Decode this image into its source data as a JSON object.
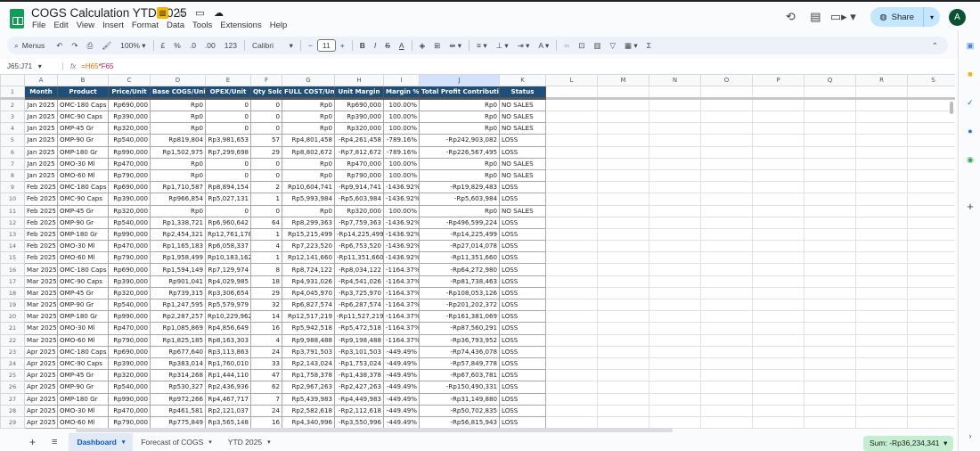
{
  "app": {
    "title": "COGS Calculation YTD 2025",
    "menu": [
      "File",
      "Edit",
      "View",
      "Insert",
      "Format",
      "Data",
      "Tools",
      "Extensions",
      "Help"
    ],
    "share_label": "Share",
    "avatar_letter": "A"
  },
  "toolbar": {
    "search": "Menus",
    "zoom": "100%",
    "currency": "£",
    "percent": "%",
    "dec_decrease": ".0",
    "dec_increase": ".00",
    "number_format": "123",
    "font": "Calibri",
    "font_size": "11"
  },
  "formula_bar": {
    "name_box": "J65:J71",
    "fx": "fx",
    "ref1": "=H65",
    "op": "*",
    "ref2": "F65"
  },
  "columns": [
    "A",
    "B",
    "C",
    "D",
    "E",
    "F",
    "G",
    "H",
    "I",
    "J",
    "K",
    "L",
    "M",
    "N",
    "O",
    "P",
    "Q",
    "R",
    "S"
  ],
  "selected_column": "J",
  "headers": [
    "Month",
    "Product",
    "Price/Unit",
    "Base COGS/Unit",
    "OPEX/Unit",
    "Qty Sold",
    "FULL COST/Unit",
    "Unit Margin",
    "Margin %",
    "Total Profit Contribution",
    "Status"
  ],
  "rows": [
    [
      "Jan 2025",
      "OMC-180 Caps",
      "Rp690,000",
      "Rp0",
      "0",
      "0",
      "Rp0",
      "Rp690,000",
      "100.00%",
      "Rp0",
      "NO SALES"
    ],
    [
      "Jan 2025",
      "OMC-90 Caps",
      "Rp390,000",
      "Rp0",
      "0",
      "0",
      "Rp0",
      "Rp390,000",
      "100.00%",
      "Rp0",
      "NO SALES"
    ],
    [
      "Jan 2025",
      "OMP-45 Gr",
      "Rp320,000",
      "Rp0",
      "0",
      "0",
      "Rp0",
      "Rp320,000",
      "100.00%",
      "Rp0",
      "NO SALES"
    ],
    [
      "Jan 2025",
      "OMP-90 Gr",
      "Rp540,000",
      "Rp819,804",
      "Rp3,981,653",
      "57",
      "Rp4,801,458",
      "-Rp4,261,458",
      "-789.16%",
      "-Rp242,903,082",
      "LOSS"
    ],
    [
      "Jan 2025",
      "OMP-180 Gr",
      "Rp990,000",
      "Rp1,502,975",
      "Rp7,299,698",
      "29",
      "Rp8,802,672",
      "-Rp7,812,672",
      "-789.16%",
      "-Rp226,567,495",
      "LOSS"
    ],
    [
      "Jan 2025",
      "OMO-30 Ml",
      "Rp470,000",
      "Rp0",
      "0",
      "0",
      "Rp0",
      "Rp470,000",
      "100.00%",
      "Rp0",
      "NO SALES"
    ],
    [
      "Jan 2025",
      "OMO-60 Ml",
      "Rp790,000",
      "Rp0",
      "0",
      "0",
      "Rp0",
      "Rp790,000",
      "100.00%",
      "Rp0",
      "NO SALES"
    ],
    [
      "Feb 2025",
      "OMC-180 Caps",
      "Rp690,000",
      "Rp1,710,587",
      "Rp8,894,154",
      "2",
      "Rp10,604,741",
      "-Rp9,914,741",
      "-1436.92%",
      "-Rp19,829,483",
      "LOSS"
    ],
    [
      "Feb 2025",
      "OMC-90 Caps",
      "Rp390,000",
      "Rp966,854",
      "Rp5,027,131",
      "1",
      "Rp5,993,984",
      "-Rp5,603,984",
      "-1436.92%",
      "-Rp5,603,984",
      "LOSS"
    ],
    [
      "Feb 2025",
      "OMP-45 Gr",
      "Rp320,000",
      "Rp0",
      "0",
      "0",
      "Rp0",
      "Rp320,000",
      "100.00%",
      "Rp0",
      "NO SALES"
    ],
    [
      "Feb 2025",
      "OMP-90 Gr",
      "Rp540,000",
      "Rp1,338,721",
      "Rp6,960,642",
      "64",
      "Rp8,299,363",
      "-Rp7,759,363",
      "-1436.92%",
      "-Rp496,599,224",
      "LOSS"
    ],
    [
      "Feb 2025",
      "OMP-180 Gr",
      "Rp990,000",
      "Rp2,454,321",
      "Rp12,761,178",
      "1",
      "Rp15,215,499",
      "-Rp14,225,499",
      "-1436.92%",
      "-Rp14,225,499",
      "LOSS"
    ],
    [
      "Feb 2025",
      "OMO-30 Ml",
      "Rp470,000",
      "Rp1,165,183",
      "Rp6,058,337",
      "4",
      "Rp7,223,520",
      "-Rp6,753,520",
      "-1436.92%",
      "-Rp27,014,078",
      "LOSS"
    ],
    [
      "Feb 2025",
      "OMO-60 Ml",
      "Rp790,000",
      "Rp1,958,499",
      "Rp10,183,162",
      "1",
      "Rp12,141,660",
      "-Rp11,351,660",
      "-1436.92%",
      "-Rp11,351,660",
      "LOSS"
    ],
    [
      "Mar 2025",
      "OMC-180 Caps",
      "Rp690,000",
      "Rp1,594,149",
      "Rp7,129,974",
      "8",
      "Rp8,724,122",
      "-Rp8,034,122",
      "-1164.37%",
      "-Rp64,272,980",
      "LOSS"
    ],
    [
      "Mar 2025",
      "OMC-90 Caps",
      "Rp390,000",
      "Rp901,041",
      "Rp4,029,985",
      "18",
      "Rp4,931,026",
      "-Rp4,541,026",
      "-1164.37%",
      "-Rp81,738,463",
      "LOSS"
    ],
    [
      "Mar 2025",
      "OMP-45 Gr",
      "Rp320,000",
      "Rp739,315",
      "Rp3,306,654",
      "29",
      "Rp4,045,970",
      "-Rp3,725,970",
      "-1164.37%",
      "-Rp108,053,126",
      "LOSS"
    ],
    [
      "Mar 2025",
      "OMP-90 Gr",
      "Rp540,000",
      "Rp1,247,595",
      "Rp5,579,979",
      "32",
      "Rp6,827,574",
      "-Rp6,287,574",
      "-1164.37%",
      "-Rp201,202,372",
      "LOSS"
    ],
    [
      "Mar 2025",
      "OMP-180 Gr",
      "Rp990,000",
      "Rp2,287,257",
      "Rp10,229,962",
      "14",
      "Rp12,517,219",
      "-Rp11,527,219",
      "-1164.37%",
      "-Rp161,381,069",
      "LOSS"
    ],
    [
      "Mar 2025",
      "OMO-30 Ml",
      "Rp470,000",
      "Rp1,085,869",
      "Rp4,856,649",
      "16",
      "Rp5,942,518",
      "-Rp5,472,518",
      "-1164.37%",
      "-Rp87,560,291",
      "LOSS"
    ],
    [
      "Mar 2025",
      "OMO-60 Ml",
      "Rp790,000",
      "Rp1,825,185",
      "Rp8,163,303",
      "4",
      "Rp9,988,488",
      "-Rp9,198,488",
      "-1164.37%",
      "-Rp36,793,952",
      "LOSS"
    ],
    [
      "Apr 2025",
      "OMC-180 Caps",
      "Rp690,000",
      "Rp677,640",
      "Rp3,113,863",
      "24",
      "Rp3,791,503",
      "-Rp3,101,503",
      "-449.49%",
      "-Rp74,436,078",
      "LOSS"
    ],
    [
      "Apr 2025",
      "OMC-90 Caps",
      "Rp390,000",
      "Rp383,014",
      "Rp1,760,010",
      "33",
      "Rp2,143,024",
      "-Rp1,753,024",
      "-449.49%",
      "-Rp57,849,778",
      "LOSS"
    ],
    [
      "Apr 2025",
      "OMP-45 Gr",
      "Rp320,000",
      "Rp314,268",
      "Rp1,444,110",
      "47",
      "Rp1,758,378",
      "-Rp1,438,378",
      "-449.49%",
      "-Rp67,603,781",
      "LOSS"
    ],
    [
      "Apr 2025",
      "OMP-90 Gr",
      "Rp540,000",
      "Rp530,327",
      "Rp2,436,936",
      "62",
      "Rp2,967,263",
      "-Rp2,427,263",
      "-449.49%",
      "-Rp150,490,331",
      "LOSS"
    ],
    [
      "Apr 2025",
      "OMP-180 Gr",
      "Rp990,000",
      "Rp972,266",
      "Rp4,467,717",
      "7",
      "Rp5,439,983",
      "-Rp4,449,983",
      "-449.49%",
      "-Rp31,149,880",
      "LOSS"
    ],
    [
      "Apr 2025",
      "OMO-30 Ml",
      "Rp470,000",
      "Rp461,581",
      "Rp2,121,037",
      "24",
      "Rp2,582,618",
      "-Rp2,112,618",
      "-449.49%",
      "-Rp50,702,835",
      "LOSS"
    ],
    [
      "Apr 2025",
      "OMO-60 Ml",
      "Rp790,000",
      "Rp775,849",
      "Rp3,565,148",
      "16",
      "Rp4,340,996",
      "-Rp3,550,996",
      "-449.49%",
      "-Rp56,815,943",
      "LOSS"
    ]
  ],
  "sheets": [
    {
      "label": "Dashboard",
      "active": true
    },
    {
      "label": "Forecast of COGS",
      "active": false
    },
    {
      "label": "YTD 2025",
      "active": false
    }
  ],
  "status": {
    "sum": "Sum: -Rp36,234,341"
  },
  "colors": {
    "header_bg": "#1f4e79",
    "accent": "#0b57d0",
    "share_bg": "#c2e7ff",
    "sum_bg": "#c4eed0"
  }
}
